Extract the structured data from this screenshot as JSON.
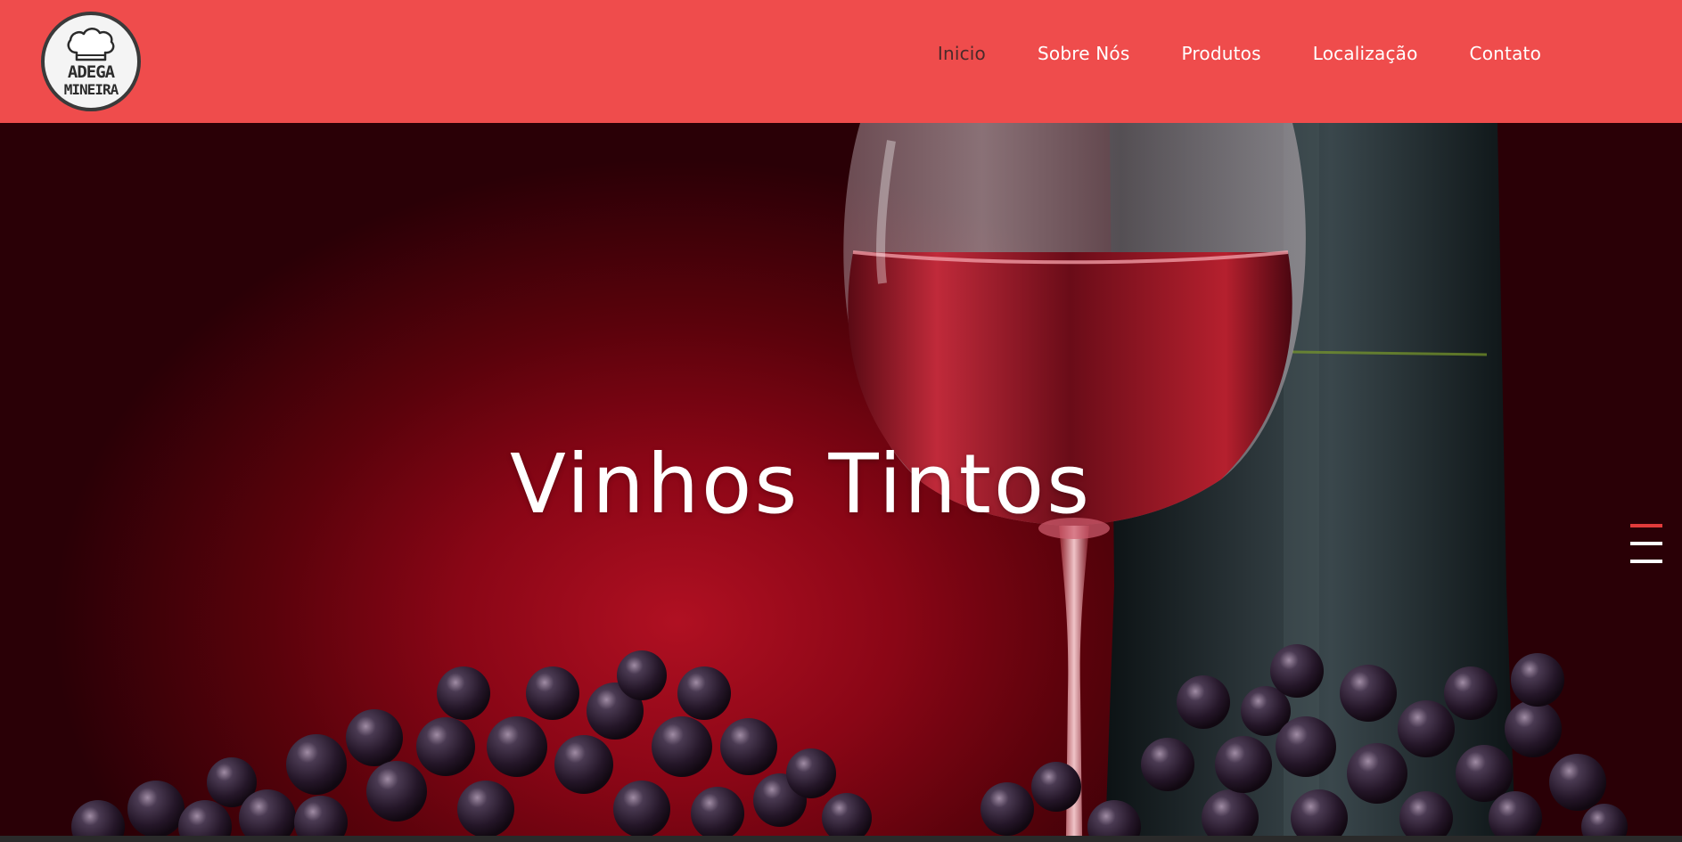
{
  "brand": {
    "logo_line1": "ADEGA",
    "logo_line2": "MINEIRA",
    "header_color": "#ef4c4c"
  },
  "nav": {
    "items": [
      {
        "label": "Inicio",
        "active": true
      },
      {
        "label": "Sobre Nós",
        "active": false
      },
      {
        "label": "Produtos",
        "active": false
      },
      {
        "label": "Localização",
        "active": false
      },
      {
        "label": "Contato",
        "active": false
      }
    ]
  },
  "hero": {
    "title": "Vinhos Tintos",
    "background_color": "#8a0616"
  },
  "slider": {
    "slide_count": 3,
    "active_index": 0,
    "active_color": "#e23b3b"
  }
}
